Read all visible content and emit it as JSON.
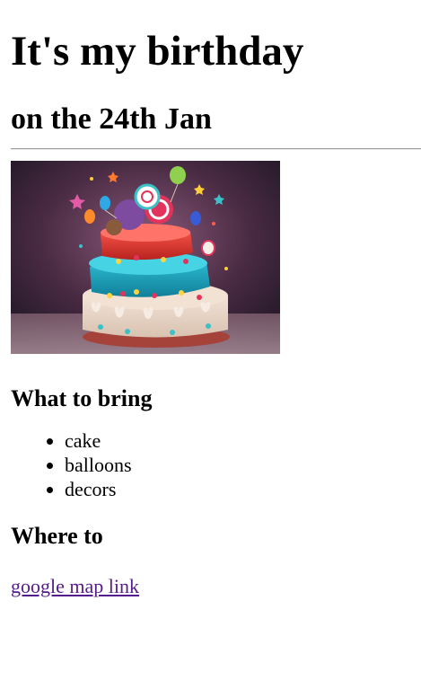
{
  "page": {
    "title": "It's my birthday",
    "subtitle": "on the 24th Jan",
    "image_alt": "birthday cake",
    "bring_heading": "What to bring",
    "bring_items": [
      "cake",
      "balloons",
      "decors"
    ],
    "where_heading": "Where to",
    "map_link_text": "google map link"
  }
}
